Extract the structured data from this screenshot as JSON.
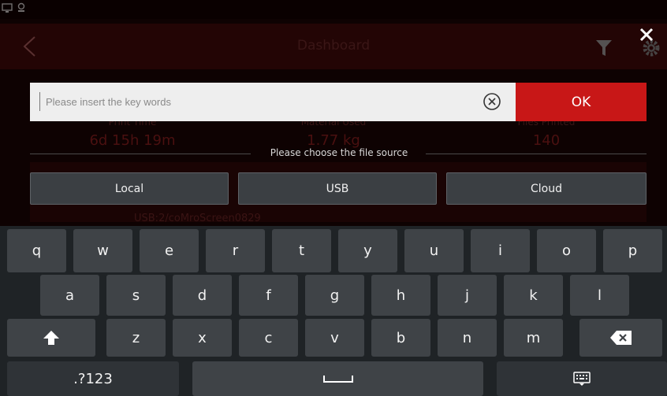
{
  "app": {
    "title": "Dashboard",
    "stats": [
      {
        "label": "Print Time",
        "value": "6d 15h 19m"
      },
      {
        "label": "Material Used",
        "value": "1.77 kg"
      },
      {
        "label": "Files Printed",
        "value": "140"
      }
    ],
    "usb_path": "USB:2/coMroScreen0829"
  },
  "search": {
    "placeholder": "Please insert the key words",
    "ok_label": "OK"
  },
  "file_source": {
    "label": "Please choose the file source",
    "options": [
      "Local",
      "USB",
      "Cloud"
    ]
  },
  "keyboard": {
    "row1": [
      "q",
      "w",
      "e",
      "r",
      "t",
      "y",
      "u",
      "i",
      "o",
      "p"
    ],
    "row2": [
      "a",
      "s",
      "d",
      "f",
      "g",
      "h",
      "j",
      "k",
      "l"
    ],
    "row3": [
      "z",
      "x",
      "c",
      "v",
      "b",
      "n",
      "m"
    ],
    "symbols_label": ".?123"
  },
  "colors": {
    "accent": "#c81717",
    "key": "#3f4347",
    "keyboard_bg": "#1f2326"
  },
  "icons": {
    "back": "chevron-left-icon",
    "filter": "filter-icon",
    "settings": "gear-icon",
    "close": "close-icon",
    "clear": "clear-circle-icon",
    "shift": "shift-arrow-icon",
    "backspace": "backspace-icon",
    "space": "space-bar-icon",
    "hide_keyboard": "keyboard-icon"
  }
}
